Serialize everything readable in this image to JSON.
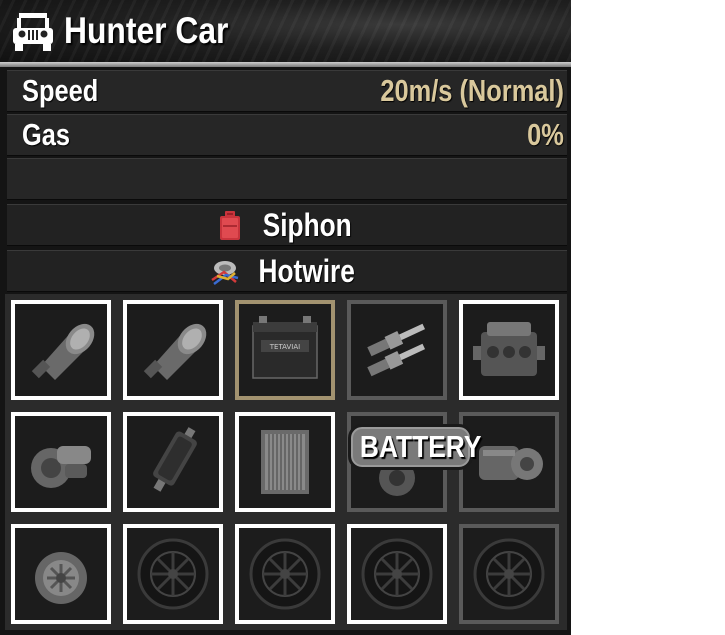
{
  "vehicle": {
    "title": "Hunter Car",
    "icon": "jeep-icon"
  },
  "stats": [
    {
      "label": "Speed",
      "value": "20m/s (Normal)"
    },
    {
      "label": "Gas",
      "value": "0%"
    }
  ],
  "actions": [
    {
      "label": "Siphon",
      "icon": "gas-can-icon"
    },
    {
      "label": "Hotwire",
      "icon": "hotwire-icon"
    }
  ],
  "parts": [
    {
      "icon": "headlight-icon",
      "border": "white"
    },
    {
      "icon": "headlight-icon",
      "border": "white"
    },
    {
      "icon": "car-battery-icon",
      "border": "tan",
      "battery_brand": "TETAVIAI"
    },
    {
      "icon": "spark-plugs-icon",
      "border": "grey"
    },
    {
      "icon": "engine-icon",
      "border": "white"
    },
    {
      "icon": "starter-motor-icon",
      "border": "white"
    },
    {
      "icon": "fuel-filter-icon",
      "border": "white"
    },
    {
      "icon": "radiator-icon",
      "border": "white"
    },
    {
      "icon": "motor-icon",
      "border": "grey"
    },
    {
      "icon": "transmission-icon",
      "border": "grey"
    },
    {
      "icon": "alternator-icon",
      "border": "white"
    },
    {
      "icon": "wheel-icon",
      "border": "white"
    },
    {
      "icon": "wheel-icon",
      "border": "white"
    },
    {
      "icon": "wheel-icon",
      "border": "white"
    },
    {
      "icon": "wheel-icon",
      "border": "grey"
    }
  ],
  "tooltip": {
    "label": "BATTERY"
  },
  "colors": {
    "value_text": "#d9c89c",
    "slot_selected": "#a39370",
    "slot_filled": "#ffffff",
    "slot_empty": "#5a5a5a"
  }
}
